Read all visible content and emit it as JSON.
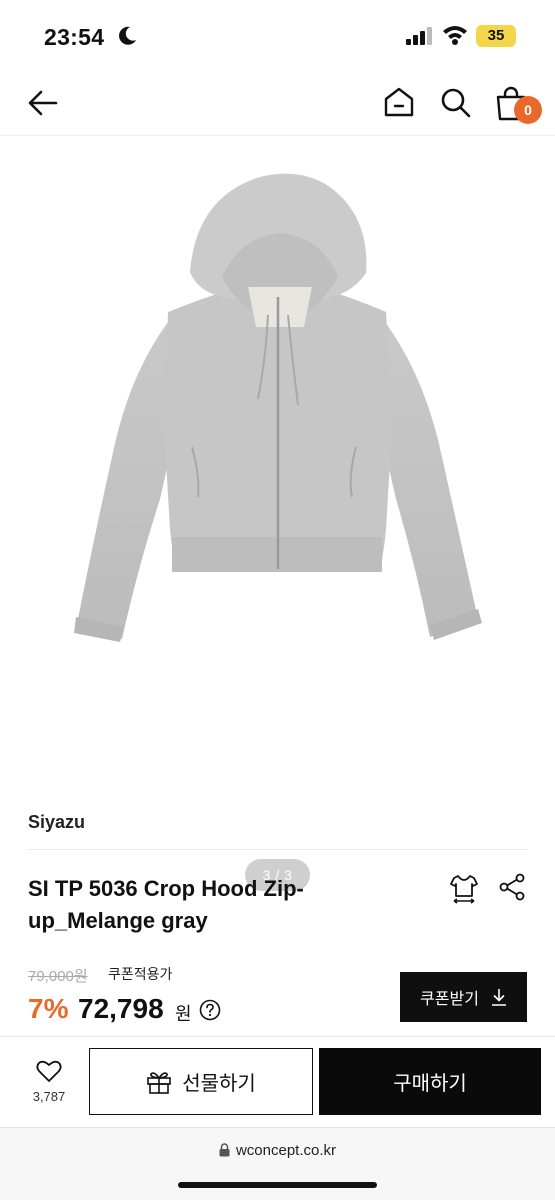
{
  "status_bar": {
    "time": "23:54",
    "battery": "35",
    "battery_color": "#f3d64a"
  },
  "nav": {
    "icons": [
      "back-arrow-icon",
      "home-icon",
      "search-icon",
      "shopping-bag-icon"
    ],
    "cart_count": "0",
    "accent": "#e8692a"
  },
  "gallery": {
    "pager": "3 / 3",
    "image": "gray-zip-up-hoodie"
  },
  "product": {
    "brand": "Siyazu",
    "title": "SI TP 5036 Crop Hood Zip-up_Melange gray",
    "original_price": "79,000원",
    "coupon_note": "쿠폰적용가",
    "discount": "7%",
    "price": "72,798",
    "currency": "원",
    "coupon_button": "쿠폰받기"
  },
  "bottom_bar": {
    "like_count": "3,787",
    "gift_label": "선물하기",
    "buy_label": "구매하기"
  },
  "browser": {
    "url": "wconcept.co.kr"
  }
}
